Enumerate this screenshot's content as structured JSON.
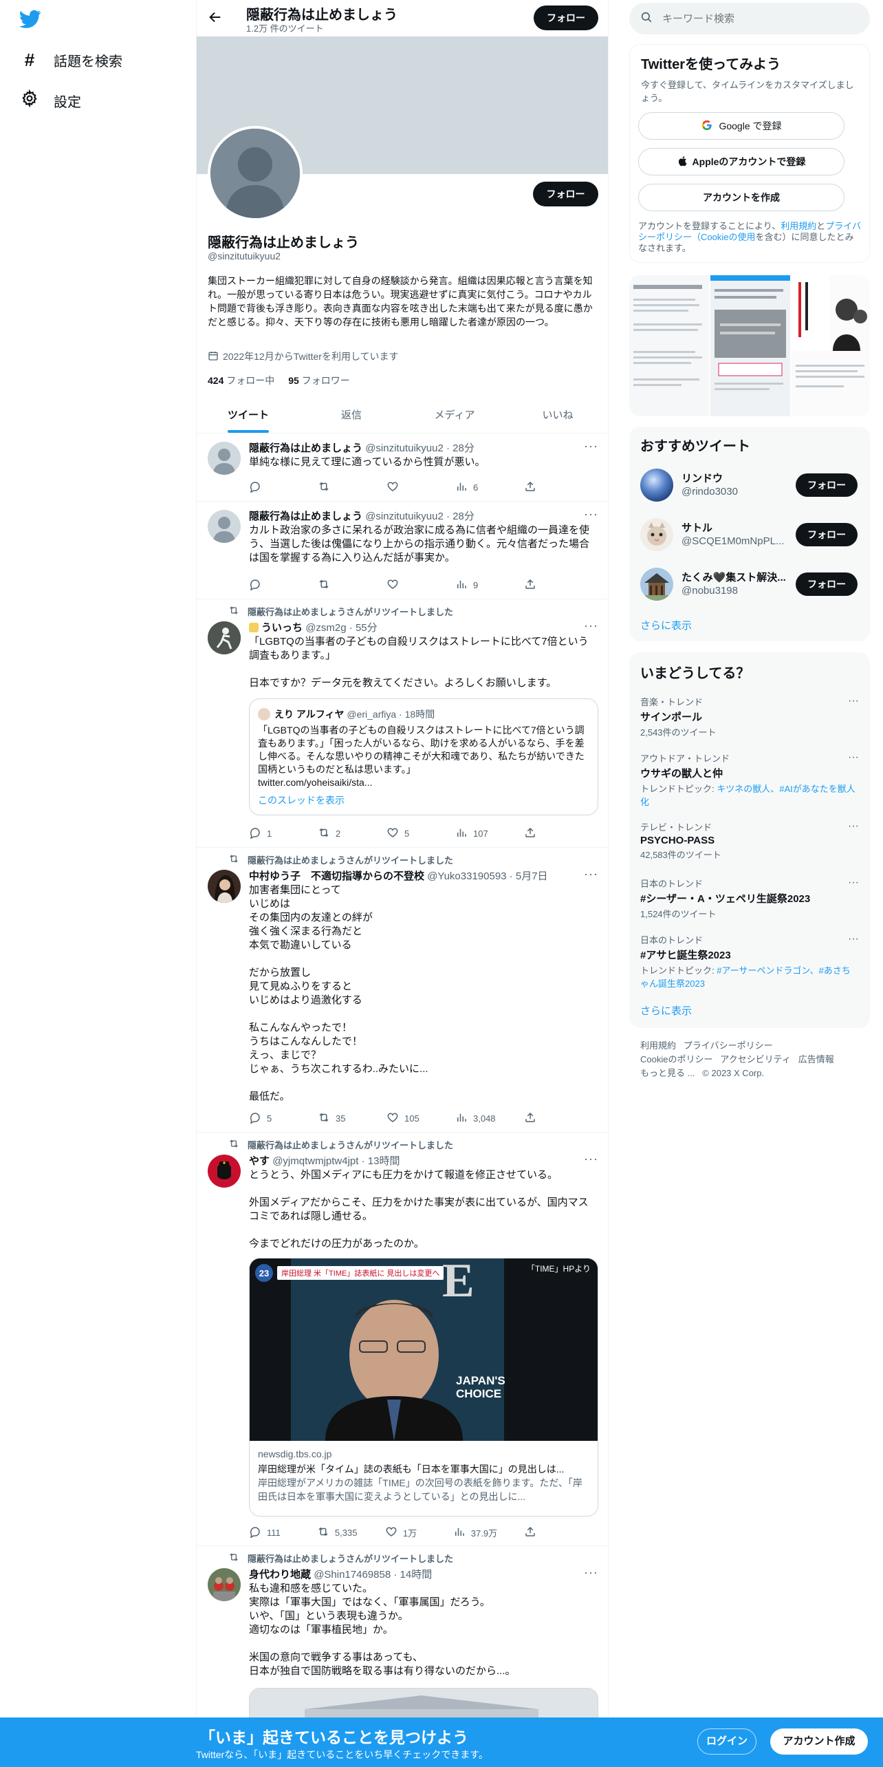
{
  "nav": {
    "explore_label": "話題を検索",
    "settings_label": "設定"
  },
  "header": {
    "name": "隠蔽行為は止めましょう",
    "tweet_count": "1.2万 件のツイート",
    "follow_label": "フォロー"
  },
  "profile": {
    "follow_label": "フォロー",
    "name": "隠蔽行為は止めましょう",
    "handle": "@sinzitutuikyuu2",
    "bio": "集団ストーカー組織犯罪に対して自身の経験談から発言。組織は因果応報と言う言葉を知れ。一般が思っている寄り日本は危うい。現実逃避せずに真実に気付こう。コロナやカルト問題で背後も浮き彫り。表向き真面な内容を呟き出した末端も出て来たが見る度に愚かだと感じる。抑々、天下り等の存在に技術も悪用し暗躍した者達が原因の一つ。",
    "joined": "2022年12月からTwitterを利用しています",
    "following_count": "424",
    "following_label": "フォロー中",
    "followers_count": "95",
    "followers_label": "フォロワー"
  },
  "tabs": [
    {
      "label": "ツイート"
    },
    {
      "label": "返信"
    },
    {
      "label": "メディア"
    },
    {
      "label": "いいね"
    }
  ],
  "tweets": [
    {
      "name": "隠蔽行為は止めましょう",
      "handle": "@sinzitutuikyuu2",
      "time": "28分",
      "text": "単純な様に見えて理に適っているから性質が悪い。",
      "replies": "",
      "retweets": "",
      "likes": "",
      "views": "6"
    },
    {
      "name": "隠蔽行為は止めましょう",
      "handle": "@sinzitutuikyuu2",
      "time": "28分",
      "text": "カルト政治家の多さに呆れるが政治家に成る為に信者や組織の一員達を使う、当選した後は傀儡になり上からの指示通り動く。元々信者だった場合は国を掌握する為に入り込んだ話が事実か。",
      "replies": "",
      "retweets": "",
      "likes": "",
      "views": "9"
    },
    {
      "retweet_label": "隠蔽行為は止めましょうさんがリツイートしました",
      "name": "ういっち",
      "handle": "@zsm2g",
      "time": "55分",
      "text": "「LGBTQの当事者の子どもの自殺リスクはストレートに比べて7倍という調査もあります。」\n\n日本ですか？データ元を教えてください。よろしくお願いします。",
      "quote": {
        "name": "えり アルフィヤ",
        "handle": "@eri_arfiya",
        "time": "18時間",
        "text": "「LGBTQの当事者の子どもの自殺リスクはストレートに比べて7倍という調査もあります。」「困った人がいるなら、助けを求める人がいるなら、手を差し伸べる。そんな思いやりの精神こそが大和魂であり、私たちが紡いできた国柄というものだと私は思います。」",
        "url": "twitter.com/yoheisaiki/sta...",
        "thread_label": "このスレッドを表示"
      },
      "replies": "1",
      "retweets": "2",
      "likes": "5",
      "views": "107"
    },
    {
      "retweet_label": "隠蔽行為は止めましょうさんがリツイートしました",
      "name": "中村ゆう子　不適切指導からの不登校",
      "handle": "@Yuko33190593",
      "time": "5月7日",
      "text": "加害者集団にとって\nいじめは\nその集団内の友達との絆が\n強く強く深まる行為だと\n本気で勘違いしている\n\nだから放置し\n見て見ぬふりをすると\nいじめはより過激化する\n\n私こんなんやったで！\nうちはこんなんしたで！\nえっ、まじで？\nじゃぁ、うち次これするわ..みたいに...\n\n最低だ。",
      "replies": "5",
      "retweets": "35",
      "likes": "105",
      "views": "3,048"
    },
    {
      "retweet_label": "隠蔽行為は止めましょうさんがリツイートしました",
      "name": "やす",
      "handle": "@yjmqtwmjptw4jpt",
      "time": "13時間",
      "text": "とうとう、外国メディアにも圧力をかけて報道を修正させている。\n\n外国メディアだからこそ、圧力をかけた事実が表に出ているが、国内マスコミであれば隠し通せる。\n\n今までどれだけの圧力があったのか。",
      "card": {
        "overlay_date": "23",
        "overlay_text": "岸田総理 米「TIME」誌表紙に 見出しは変更へ",
        "overlay_source": "「TIME」HPより",
        "cover_title": "JAPAN'S CHOICE",
        "domain": "newsdig.tbs.co.jp",
        "title": "岸田総理が米「タイム」誌の表紙も「日本を軍事大国に」の見出しは...",
        "desc": "岸田総理がアメリカの雑誌「TIME」の次回号の表紙を飾ります。ただ、「岸田氏は日本を軍事大国に変えようとしている」との見出しに..."
      },
      "replies": "111",
      "retweets": "5,335",
      "likes": "1万",
      "views": "37.9万"
    },
    {
      "retweet_label": "隠蔽行為は止めましょうさんがリツイートしました",
      "name": "身代わり地蔵",
      "handle": "@Shin17469858",
      "time": "14時間",
      "text": "私も違和感を感じていた。\n実際は「軍事大国」ではなく、「軍事属国」だろう。\nいや、「国」という表現も違うか。\n適切なのは「軍事植民地」か。\n\n米国の意向で戦争する事はあっても、\n日本が独自で国防戦略を取る事は有り得ないのだから...。"
    }
  ],
  "search": {
    "placeholder": "キーワード検索"
  },
  "signup": {
    "title": "Twitterを使ってみよう",
    "subtitle": "今すぐ登録して、タイムラインをカスタマイズしましょう。",
    "google_label": "Google で登録",
    "apple_label": "Appleのアカウントで登録",
    "create_label": "アカウントを作成",
    "terms_prefix": "アカウントを登録することにより、",
    "terms_link": "利用規約",
    "and": "と",
    "privacy_link": "プライバシーポリシー",
    "cookie_link": "（Cookieの使用",
    "terms_suffix": "を含む）に同意したとみなされます。"
  },
  "recommended": {
    "title": "おすすめツイート",
    "follow_label": "フォロー",
    "more_label": "さらに表示",
    "users": [
      {
        "name": "リンドウ",
        "handle": "@rindo3030"
      },
      {
        "name": "サトル",
        "handle": "@SCQE1M0mNpPL..."
      },
      {
        "name": "たくみ🖤集スト解決...",
        "handle": "@nobu3198"
      }
    ]
  },
  "trends": {
    "title": "いまどうしてる？",
    "more_label": "さらに表示",
    "items": [
      {
        "category": "音楽・トレンド",
        "name": "サインポール",
        "count": "2,543件のツイート",
        "topics_label": "",
        "topics": ""
      },
      {
        "category": "アウトドア・トレンド",
        "name": "ウサギの獣人と仲",
        "count": "",
        "topics_label": "トレンドトピック: ",
        "topics": "キツネの獣人、#AIがあなたを獣人化"
      },
      {
        "category": "テレビ・トレンド",
        "name": "PSYCHO-PASS",
        "count": "42,583件のツイート",
        "topics_label": "",
        "topics": ""
      },
      {
        "category": "日本のトレンド",
        "name": "#シーザー・A・ツェペリ生誕祭2023",
        "count": "1,524件のツイート",
        "topics_label": "",
        "topics": ""
      },
      {
        "category": "日本のトレンド",
        "name": "#アサヒ誕生祭2023",
        "count": "",
        "topics_label": "トレンドトピック: ",
        "topics": "#アーサーペンドラゴン、#あさちゃん誕生祭2023"
      }
    ]
  },
  "footer": {
    "links": [
      "利用規約",
      "プライバシーポリシー",
      "Cookieのポリシー",
      "アクセシビリティ",
      "広告情報",
      "もっと見る ..."
    ],
    "copyright": "© 2023 X Corp."
  },
  "bottombar": {
    "title": "「いま」起きていることを見つけよう",
    "subtitle": "Twitterなら、「いま」起きていることをいち早くチェックできます。",
    "login_label": "ログイン",
    "signup_label": "アカウント作成"
  },
  "colors": {
    "accent": "#1d9bf0",
    "text": "#0f1419",
    "muted": "#536471"
  }
}
